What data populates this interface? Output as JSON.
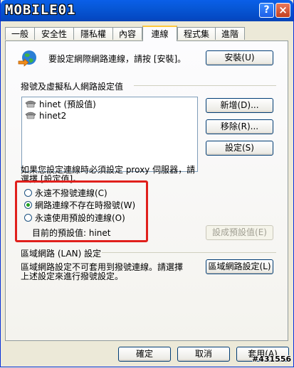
{
  "window": {
    "brand_logo": "MOBILE01",
    "help_label": "?",
    "close_label": "×"
  },
  "tabs": [
    {
      "label": "一般"
    },
    {
      "label": "安全性"
    },
    {
      "label": "隱私權"
    },
    {
      "label": "內容"
    },
    {
      "label": "連線"
    },
    {
      "label": "程式集"
    },
    {
      "label": "進階"
    }
  ],
  "active_tab": "連線",
  "setup": {
    "text": "要設定網際網路連線，請按 [安裝]。",
    "button": "安裝(U)"
  },
  "dialup": {
    "section_label": "撥號及虛擬私人網路設定值",
    "connections": [
      {
        "label": "hinet (預設值)"
      },
      {
        "label": "hinet2"
      }
    ],
    "add_button": "新增(D)...",
    "remove_button": "移除(R)...",
    "settings_button": "設定(S)"
  },
  "proxy_note_line1": "如果您設定連線時必須設定 proxy 伺服器，請",
  "proxy_note_line2": "選擇 [設定值]。",
  "dial_options": [
    {
      "label": "永遠不撥號連線(C)",
      "checked": false
    },
    {
      "label": "網路連線不存在時撥號(W)",
      "checked": true
    },
    {
      "label": "永遠使用預設的連線(O)",
      "checked": false
    }
  ],
  "current_default": "目前的預設值: hinet",
  "set_default_button": "設成預設值(E)",
  "lan": {
    "section_label": "區域網路 (LAN) 設定",
    "desc_line1": "區域網路設定不可套用到撥號連線。請選擇",
    "desc_line2": "上述設定來進行撥號設定。",
    "button": "區域網路設定(L)"
  },
  "footer": {
    "ok": "確定",
    "cancel": "取消",
    "apply": "套用(A)"
  },
  "watermark": "#431556"
}
